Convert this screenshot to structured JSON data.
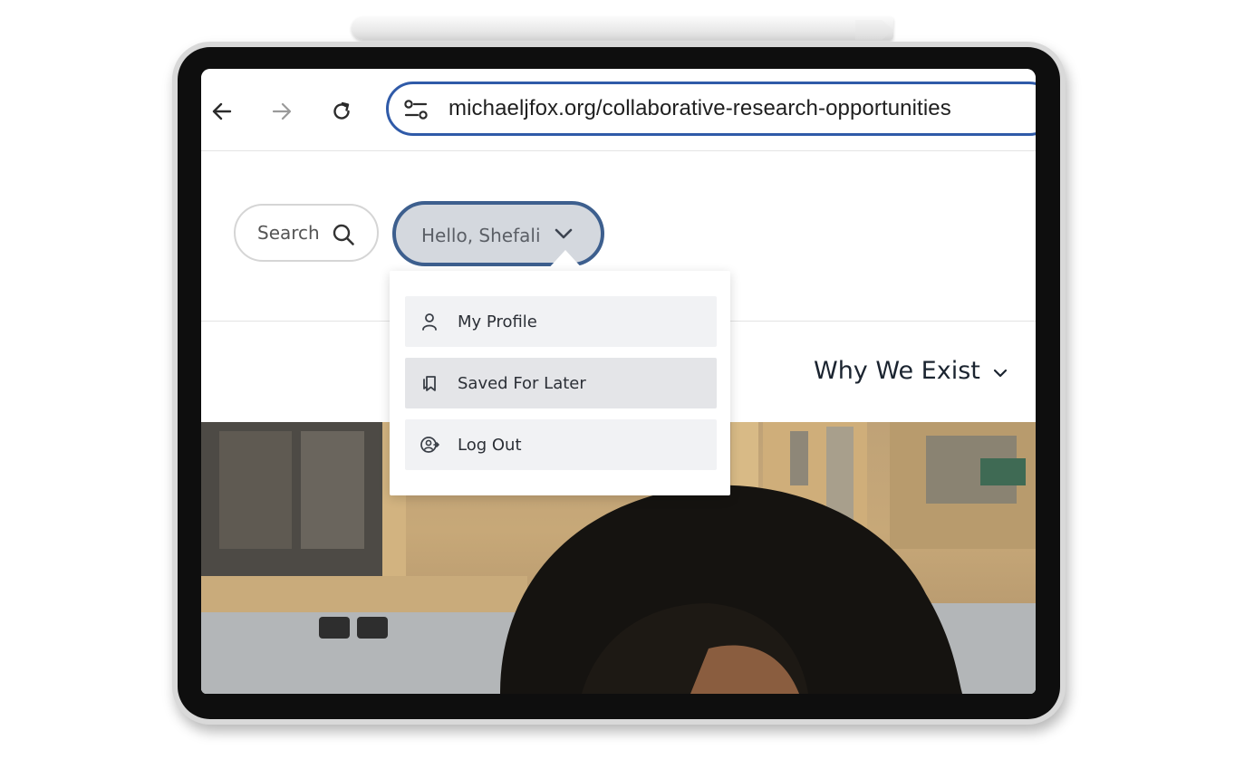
{
  "browser": {
    "url": "michaeljfox.org/collaborative-research-opportunities"
  },
  "header": {
    "search_label": "Search",
    "greeting": "Hello, Shefali",
    "nav_item": "Why We Exist"
  },
  "user_menu": {
    "items": [
      {
        "label": "My Profile",
        "icon": "person-icon"
      },
      {
        "label": "Saved For Later",
        "icon": "bookmarks-icon"
      },
      {
        "label": "Log Out",
        "icon": "logout-icon"
      }
    ],
    "highlighted_index": 1
  },
  "colors": {
    "url_border": "#2f5aa8",
    "pill_border": "#3d5f8e",
    "pill_fill": "#d4d8de",
    "menu_item_bg": "#f1f2f4",
    "menu_item_active_bg": "#e4e5e8"
  }
}
